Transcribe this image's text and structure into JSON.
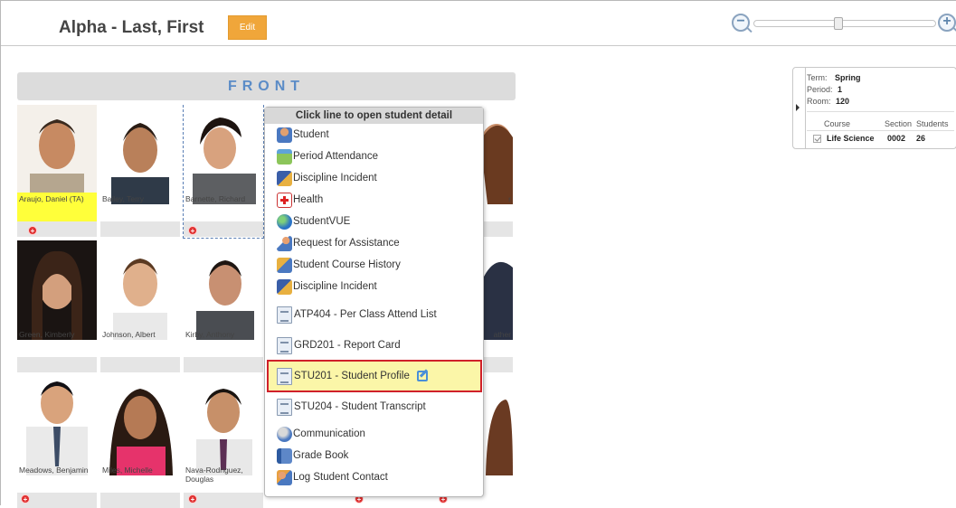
{
  "header": {
    "title": "Alpha - Last, First",
    "edit_label": "Edit",
    "zoom_minus": "−",
    "zoom_plus": "+"
  },
  "room": {
    "front_label": "FRONT"
  },
  "students": [
    {
      "name": "Araujo, Daniel (TA)",
      "highlight": true
    },
    {
      "name": "Bailey, Terry"
    },
    {
      "name": "Barnette, Richard"
    },
    {
      "name": "r"
    },
    {
      "name": "Green, Kimberly"
    },
    {
      "name": "Johnson, Albert"
    },
    {
      "name": "Kirby, Anthony"
    },
    {
      "name": "ather"
    },
    {
      "name": "Meadows, Benjamin"
    },
    {
      "name": "Miles, Michelle"
    },
    {
      "name": "Nava-Rodriguez, Douglas"
    }
  ],
  "context_menu": {
    "header": "Click line to open student detail",
    "items": [
      {
        "label": "Student",
        "icon": "student-icon"
      },
      {
        "label": "Period Attendance",
        "icon": "calendar-icon"
      },
      {
        "label": "Discipline Incident",
        "icon": "book-icon"
      },
      {
        "label": "Health",
        "icon": "health-cross-icon"
      },
      {
        "label": "StudentVUE",
        "icon": "globe-icon"
      },
      {
        "label": "Request for Assistance",
        "icon": "assistance-icon"
      },
      {
        "label": "Student Course History",
        "icon": "course-history-icon"
      },
      {
        "label": "Discipline Incident",
        "icon": "book-icon"
      },
      {
        "label": "ATP404 - Per Class Attend List",
        "icon": "report-icon"
      },
      {
        "label": "GRD201 - Report Card",
        "icon": "report-icon"
      },
      {
        "label": "STU201 - Student Profile",
        "icon": "report-icon",
        "selected": true
      },
      {
        "label": "STU204 - Student Transcript",
        "icon": "report-icon"
      },
      {
        "label": "Communication",
        "icon": "communication-icon"
      },
      {
        "label": "Grade Book",
        "icon": "gradebook-icon"
      },
      {
        "label": "Log Student Contact",
        "icon": "contact-log-icon"
      }
    ]
  },
  "class_info": {
    "term_label": "Term:",
    "term_value": "Spring",
    "period_label": "Period:",
    "period_value": "1",
    "room_label": "Room:",
    "room_value": "120",
    "col_course": "Course",
    "col_section": "Section",
    "col_students": "Students",
    "course": "Life Science",
    "section": "0002",
    "students_count": "26"
  },
  "colors": {
    "edit_button": "#f0a63a",
    "front_text": "#5b8cc7",
    "highlight_border": "#d0202a",
    "highlight_fill": "#fbf6a8",
    "ta_name_bg": "#ffff3a"
  }
}
